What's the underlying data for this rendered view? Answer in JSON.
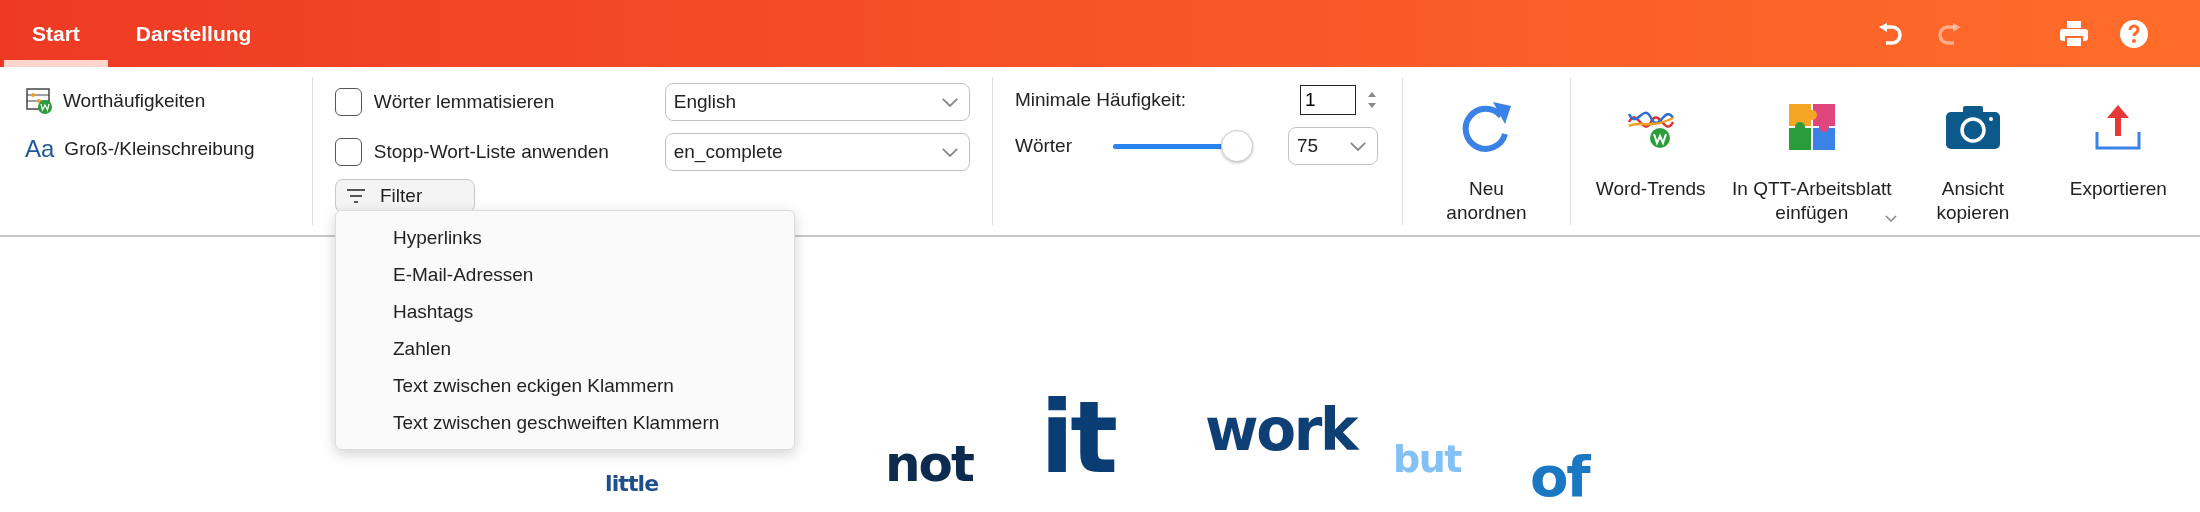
{
  "header": {
    "tabs": [
      {
        "label": "Start",
        "selected": true
      },
      {
        "label": "Darstellung",
        "selected": false
      }
    ],
    "actions": [
      {
        "kind": "undo",
        "disabled": false
      },
      {
        "kind": "redo",
        "disabled": true
      },
      {
        "kind": "print",
        "disabled": false
      },
      {
        "kind": "help",
        "disabled": false
      }
    ]
  },
  "ribbon": {
    "view_options": [
      {
        "kind": "frequencies",
        "label": "Worthäufigkeiten"
      },
      {
        "kind": "case",
        "label": "Groß-/Kleinschreibung",
        "icon_text": "Aa"
      }
    ],
    "options": [
      {
        "label": "Wörter lemmatisieren",
        "checked": false,
        "select": "English"
      },
      {
        "label": "Stopp-Wort-Liste anwenden",
        "checked": false,
        "select": "en_complete"
      }
    ],
    "filter": {
      "label": "Filter",
      "expanded": true,
      "items": [
        "Hyperlinks",
        "E-Mail-Adressen",
        "Hashtags",
        "Zahlen",
        "Text zwischen eckigen Klammern",
        "Text zwischen geschweiften Klammern"
      ]
    },
    "min_frequency": {
      "label": "Minimale Häufigkeit:",
      "value": "1"
    },
    "words": {
      "label": "Wörter",
      "level": 0.95,
      "value": "75"
    },
    "rearrange": {
      "label": "Neu anordnen"
    },
    "tools": [
      {
        "kind": "trends",
        "label": "Word-Trends",
        "menu": false
      },
      {
        "kind": "worksheet",
        "label": "In QTT-Arbeitsblatt einfügen",
        "menu": true
      },
      {
        "kind": "camera",
        "label": "Ansicht kopieren",
        "menu": false
      },
      {
        "kind": "export",
        "label": "Exportieren",
        "menu": false
      }
    ]
  },
  "cloud": [
    {
      "word": "little",
      "color": "#1f4e8c"
    },
    {
      "word": "not",
      "color": "#0d2b4e"
    },
    {
      "word": "it",
      "color": "#0a3d73"
    },
    {
      "word": "work",
      "color": "#0e3f75"
    },
    {
      "word": "but",
      "color": "#82c0f5"
    },
    {
      "word": "of",
      "color": "#1a78c2"
    }
  ]
}
